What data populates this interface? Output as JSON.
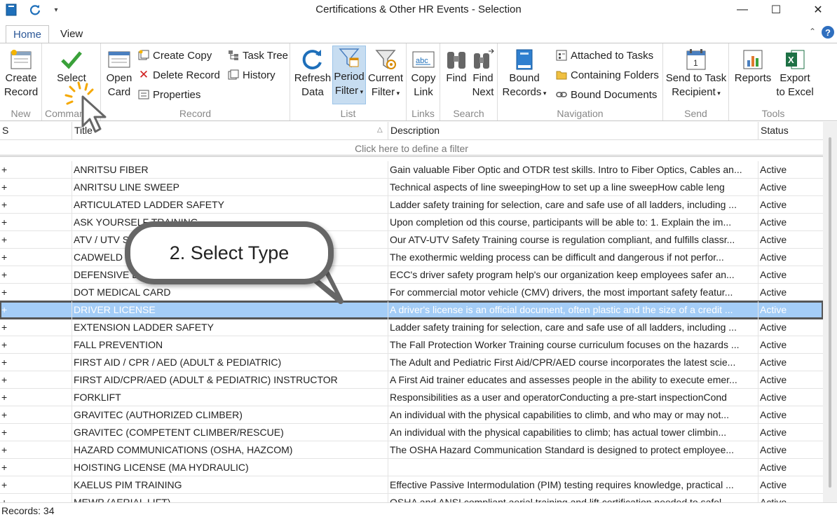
{
  "window": {
    "title": "Certifications & Other HR Events - Selection",
    "minimize": "—",
    "maximize": "☐",
    "close": "✕"
  },
  "tabs": [
    {
      "label": "Home"
    },
    {
      "label": "View"
    }
  ],
  "help": "?",
  "ribbon": {
    "new": {
      "label": "New",
      "create_record": [
        "Create",
        "Record"
      ]
    },
    "command": {
      "label": "Command",
      "select": "Select"
    },
    "record": {
      "label": "Record",
      "open_card": [
        "Open",
        "Card"
      ],
      "create_copy": "Create Copy",
      "delete_record": "Delete Record",
      "properties": "Properties",
      "task_tree": "Task Tree",
      "history": "History"
    },
    "list": {
      "label": "List",
      "refresh_data": [
        "Refresh",
        "Data"
      ],
      "period_filter": [
        "Period",
        "Filter"
      ],
      "current_filter": [
        "Current",
        "Filter"
      ]
    },
    "links": {
      "label": "Links",
      "copy_link": [
        "Copy",
        "Link"
      ]
    },
    "search": {
      "label": "Search",
      "find": "Find",
      "find_next": [
        "Find",
        "Next"
      ]
    },
    "navigation": {
      "label": "Navigation",
      "bound_records": [
        "Bound",
        "Records"
      ],
      "attached_to_tasks": "Attached to Tasks",
      "containing_folders": "Containing Folders",
      "bound_documents": "Bound Documents"
    },
    "send": {
      "label": "Send",
      "send_to_task_recipient": [
        "Send to Task",
        "Recipient"
      ]
    },
    "tools": {
      "label": "Tools",
      "reports": "Reports",
      "export_to_excel": [
        "Export",
        "to Excel"
      ]
    }
  },
  "grid": {
    "columns": {
      "s": "S",
      "title": "Title",
      "description": "Description",
      "status": "Status"
    },
    "filter_prompt": "Click here to define a filter",
    "rows": [
      {
        "s": "+",
        "title": "ANRITSU FIBER",
        "description": "Gain valuable Fiber Optic and OTDR test skills. Intro to Fiber Optics, Cables an...",
        "status": "Active"
      },
      {
        "s": "+",
        "title": "ANRITSU LINE SWEEP",
        "description": "Technical aspects of line sweepingHow to set up a line sweepHow cable leng",
        "status": "Active"
      },
      {
        "s": "+",
        "title": "ARTICULATED LADDER SAFETY",
        "description": "Ladder safety training for selection, care and safe use of all ladders, including ...",
        "status": "Active"
      },
      {
        "s": "+",
        "title": "ASK YOURSELF TRAINING",
        "description": "Upon completion od this course, participants will be able to: 1. Explain the im...",
        "status": "Active"
      },
      {
        "s": "+",
        "title": "ATV / UTV SAFETY",
        "description": "Our ATV-UTV Safety Training course is regulation compliant, and fulfills classr...",
        "status": "Active"
      },
      {
        "s": "+",
        "title": "CADWELD",
        "description": "The exothermic welding process can be difficult and dangerous if not perfor...",
        "status": "Active"
      },
      {
        "s": "+",
        "title": "DEFENSIVE DRIVING",
        "description": "ECC's driver safety program help's our organization keep employees safer an...",
        "status": "Active"
      },
      {
        "s": "+",
        "title": "DOT MEDICAL CARD",
        "description": "For commercial motor vehicle (CMV) drivers, the most important safety featur...",
        "status": "Active"
      },
      {
        "s": "+",
        "title": "DRIVER LICENSE",
        "description": "A driver's license is an official document, often plastic and the size of a credit ...",
        "status": "Active",
        "selected": true
      },
      {
        "s": "+",
        "title": "EXTENSION LADDER SAFETY",
        "description": "Ladder safety training for selection, care and safe use of all ladders, including ...",
        "status": "Active"
      },
      {
        "s": "+",
        "title": "FALL PREVENTION",
        "description": "The Fall Protection Worker Training course curriculum focuses on the hazards ...",
        "status": "Active"
      },
      {
        "s": "+",
        "title": "FIRST AID / CPR / AED (ADULT & PEDIATRIC)",
        "description": "The Adult and Pediatric First Aid/CPR/AED course incorporates the latest scie...",
        "status": "Active"
      },
      {
        "s": "+",
        "title": "FIRST AID/CPR/AED (ADULT & PEDIATRIC) INSTRUCTOR",
        "description": "A First Aid trainer educates and assesses people in the ability to execute emer...",
        "status": "Active"
      },
      {
        "s": "+",
        "title": "FORKLIFT",
        "description": "Responsibilities as a user and operatorConducting a pre-start inspectionCond",
        "status": "Active"
      },
      {
        "s": "+",
        "title": "GRAVITEC (AUTHORIZED CLIMBER)",
        "description": "An individual with the physical capabilities to climb, and who may or may not...",
        "status": "Active"
      },
      {
        "s": "+",
        "title": "GRAVITEC (COMPETENT CLIMBER/RESCUE)",
        "description": "An individual with the physical capabilities to climb; has actual tower climbin...",
        "status": "Active"
      },
      {
        "s": "+",
        "title": "HAZARD COMMUNICATIONS (OSHA, HAZCOM)",
        "description": "The OSHA Hazard Communication Standard is designed to protect employee...",
        "status": "Active"
      },
      {
        "s": "+",
        "title": "HOISTING LICENSE (MA HYDRAULIC)",
        "description": "",
        "status": "Active"
      },
      {
        "s": "+",
        "title": "KAELUS PIM TRAINING",
        "description": "Effective Passive Intermodulation (PIM) testing requires knowledge, practical ...",
        "status": "Active"
      },
      {
        "s": "+",
        "title": "MEWP (AERIAL LIFT)",
        "description": "OSHA and ANSI compliant aerial training and lift certification needed to safel...",
        "status": "Active"
      }
    ]
  },
  "status_bar": {
    "records": "Records: 34"
  },
  "callout": {
    "text": "2. Select Type"
  },
  "colors": {
    "selection": "#a4cdf7",
    "accent": "#2b5797",
    "pressed": "#c7ddf1"
  }
}
